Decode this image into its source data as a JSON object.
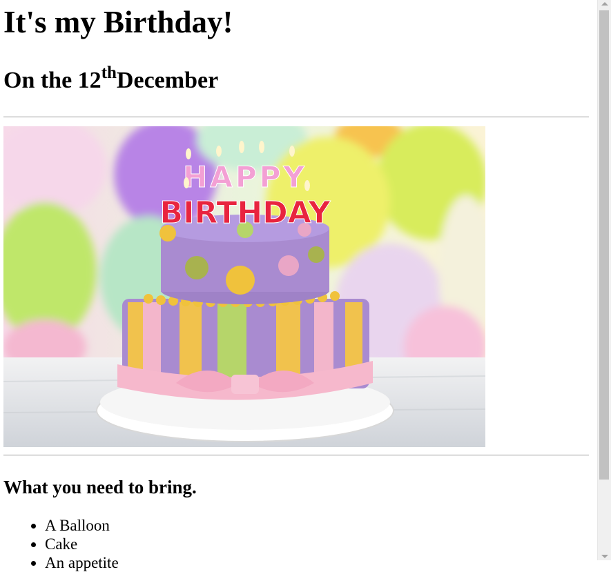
{
  "page": {
    "title": "It's my Birthday!",
    "subtitle_prefix": "On the 12",
    "subtitle_sup": "th",
    "subtitle_suffix": "December",
    "image": {
      "caption_top": "HAPPY",
      "caption_bottom": "BIRTHDAY",
      "colors": {
        "cake_purple": "#a98bd0",
        "stripe_yellow": "#f1c24d",
        "stripe_green": "#b6d56a",
        "stripe_pink": "#f3b6cb",
        "ribbon_pink": "#f6b8cc",
        "dot_green": "#a8b24f",
        "dot_yellow": "#f0c23c",
        "dot_pink": "#e9a6c6"
      }
    },
    "bring_heading": "What you need to bring.",
    "bring_items": [
      "A Balloon",
      "Cake",
      "An appetite"
    ]
  }
}
